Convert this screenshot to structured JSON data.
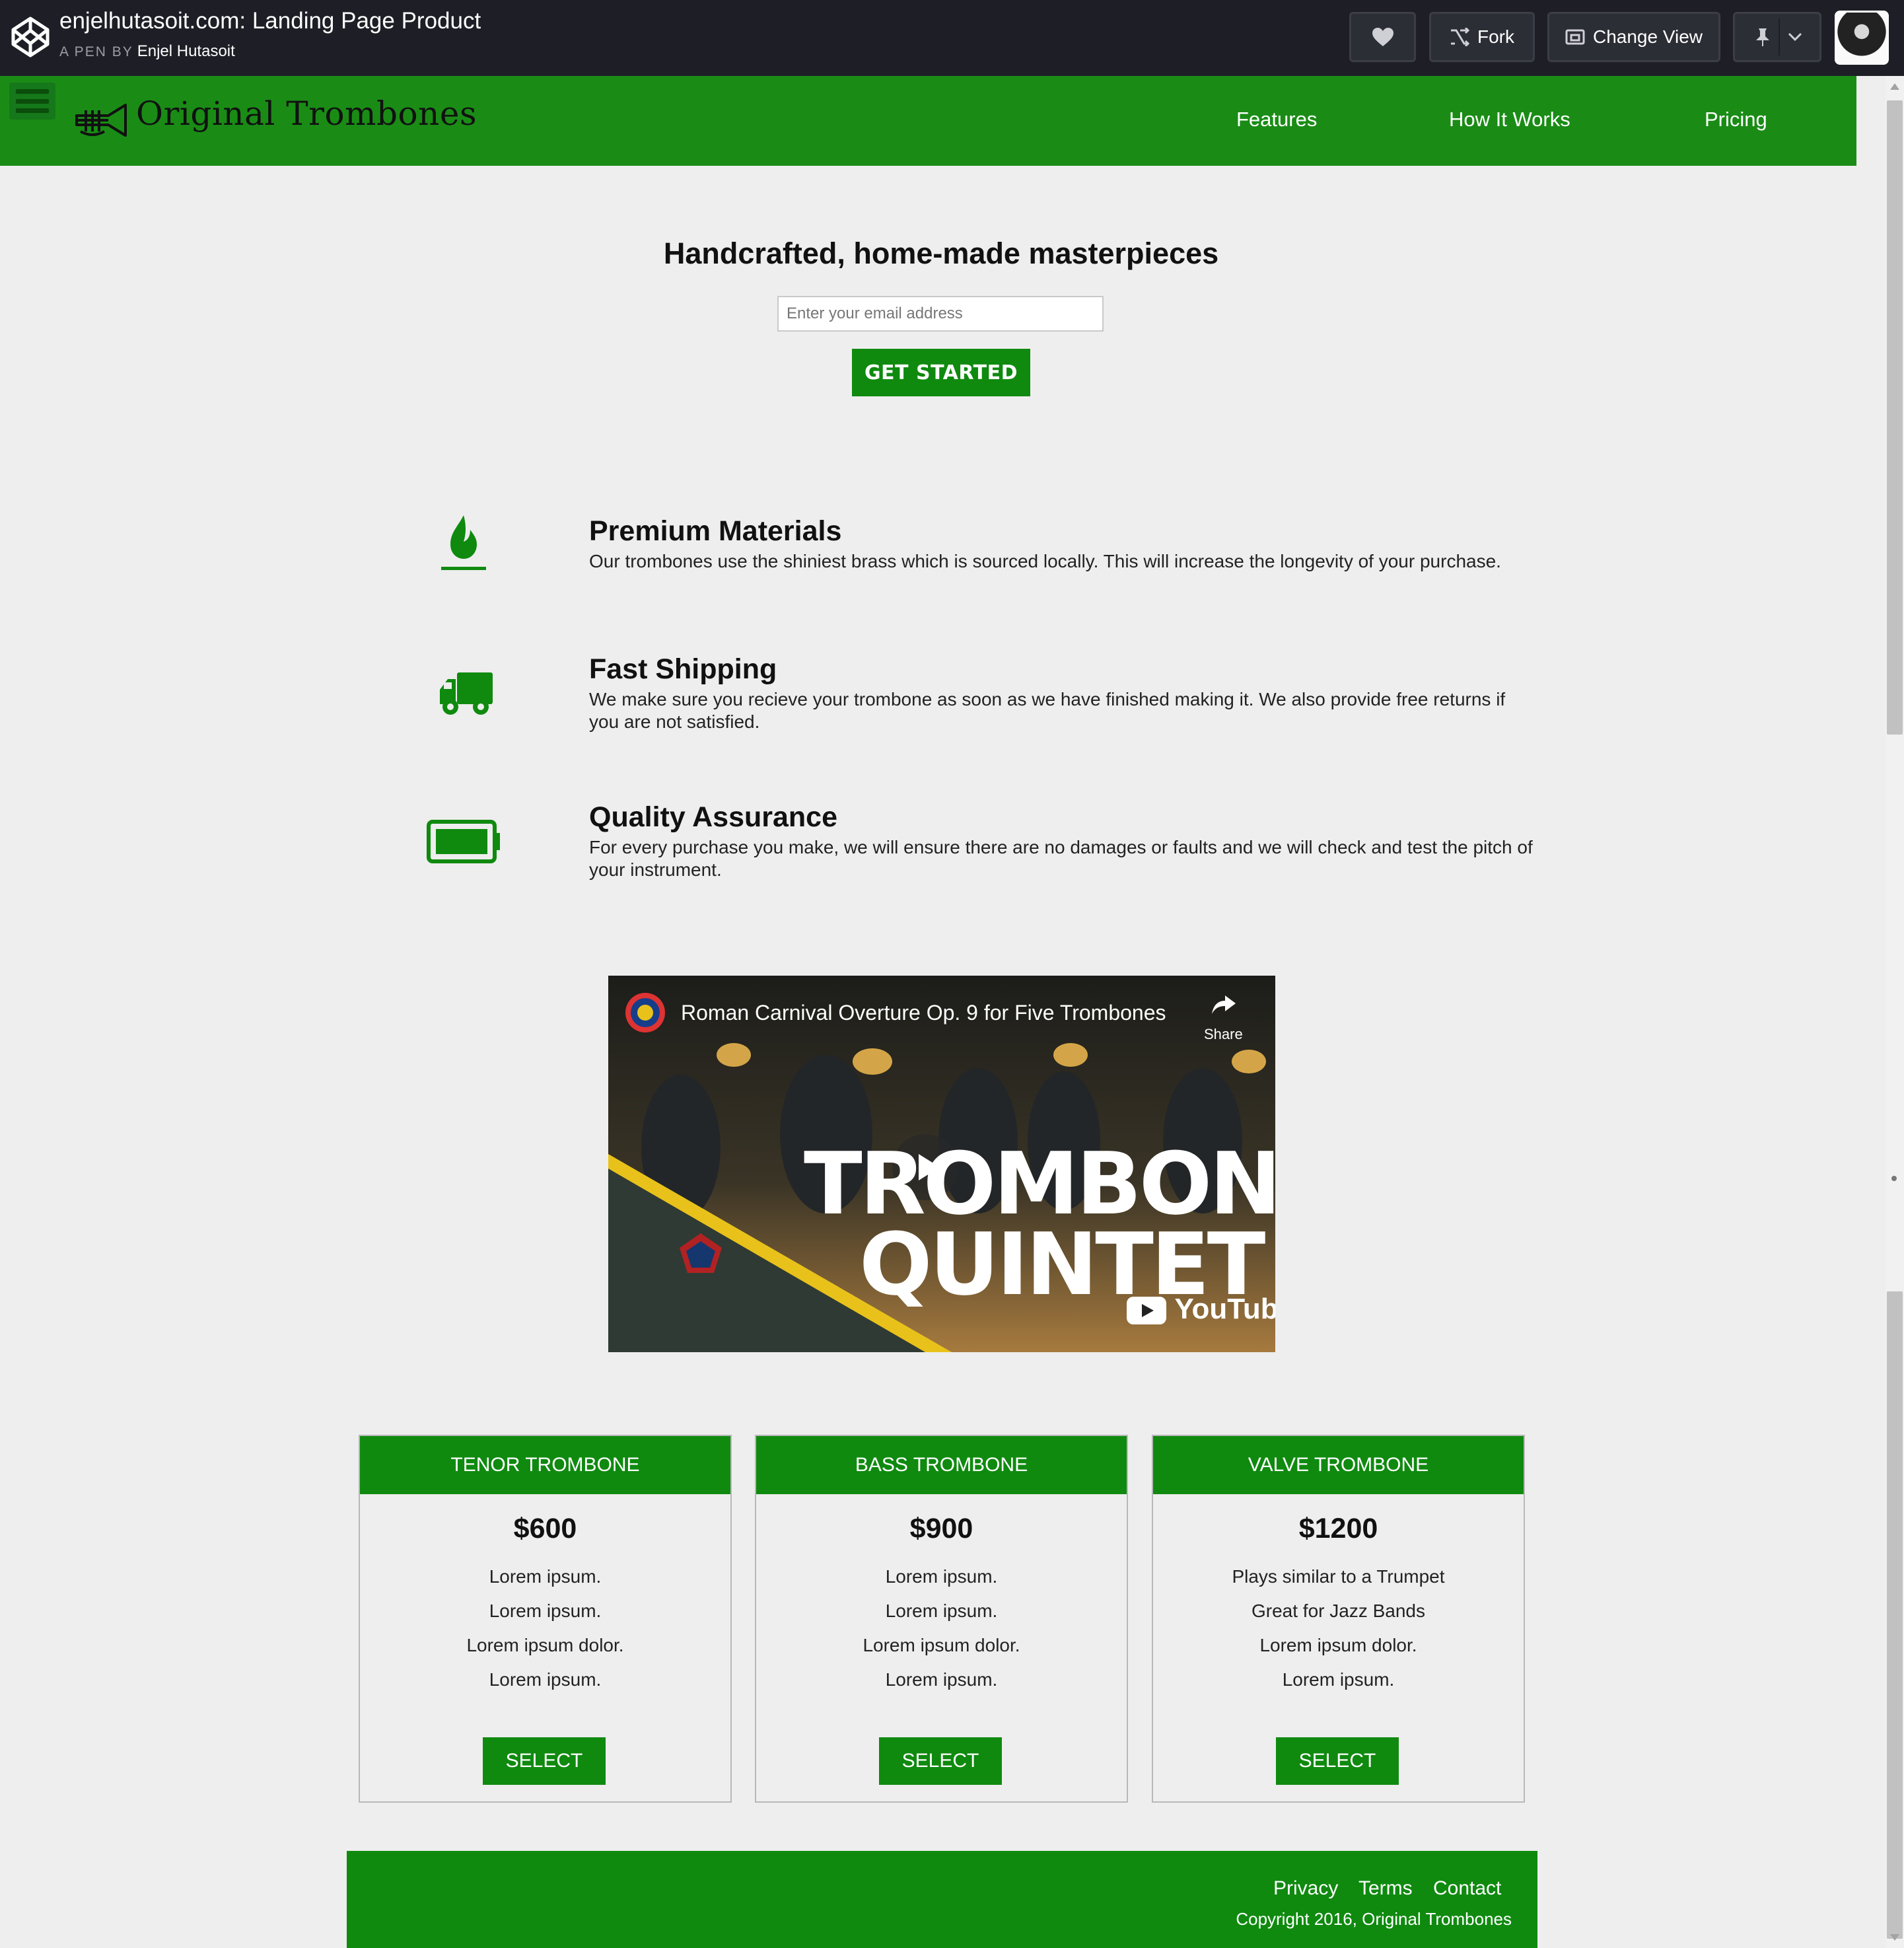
{
  "codepen": {
    "pen_title": "enjelhutasoit.com: Landing Page Product",
    "by_label": "A PEN BY",
    "author": "Enjel Hutasoit",
    "fork_label": "Fork",
    "change_view_label": "Change View"
  },
  "site": {
    "brand": "Original Trombones",
    "nav": [
      "Features",
      "How It Works",
      "Pricing"
    ]
  },
  "hero": {
    "title": "Handcrafted, home-made masterpieces",
    "email_placeholder": "Enter your email address",
    "cta_label": "GET STARTED"
  },
  "features": [
    {
      "icon": "fire-icon",
      "title": "Premium Materials",
      "description": "Our trombones use the shiniest brass which is sourced locally. This will increase the longevity of your purchase."
    },
    {
      "icon": "truck-icon",
      "title": "Fast Shipping",
      "description": "We make sure you recieve your trombone as soon as we have finished making it. We also provide free returns if you are not satisfied."
    },
    {
      "icon": "battery-full-icon",
      "title": "Quality Assurance",
      "description": "For every purchase you make, we will ensure there are no damages or faults and we will check and test the pitch of your instrument."
    }
  ],
  "video": {
    "title": "Roman Carnival Overture Op. 9 for Five Trombones",
    "share_label": "Share",
    "overlay_line1": "TROMBONE",
    "overlay_line2": "QUINTET",
    "platform": "YouTube"
  },
  "pricing": [
    {
      "name": "TENOR TROMBONE",
      "price": "$600",
      "features": [
        "Lorem ipsum.",
        "Lorem ipsum.",
        "Lorem ipsum dolor.",
        "Lorem ipsum."
      ],
      "button": "SELECT"
    },
    {
      "name": "BASS TROMBONE",
      "price": "$900",
      "features": [
        "Lorem ipsum.",
        "Lorem ipsum.",
        "Lorem ipsum dolor.",
        "Lorem ipsum."
      ],
      "button": "SELECT"
    },
    {
      "name": "VALVE TROMBONE",
      "price": "$1200",
      "features": [
        "Plays similar to a Trumpet",
        "Great for Jazz Bands",
        "Lorem ipsum dolor.",
        "Lorem ipsum."
      ],
      "button": "SELECT"
    }
  ],
  "footer": {
    "links": [
      "Privacy",
      "Terms",
      "Contact"
    ],
    "copyright": "Copyright 2016, Original Trombones"
  },
  "colors": {
    "brand_green": "#1a8c16",
    "button_green": "#0f8a0f",
    "codepen_bar": "#1e1f26",
    "page_background": "#eeeeee"
  }
}
